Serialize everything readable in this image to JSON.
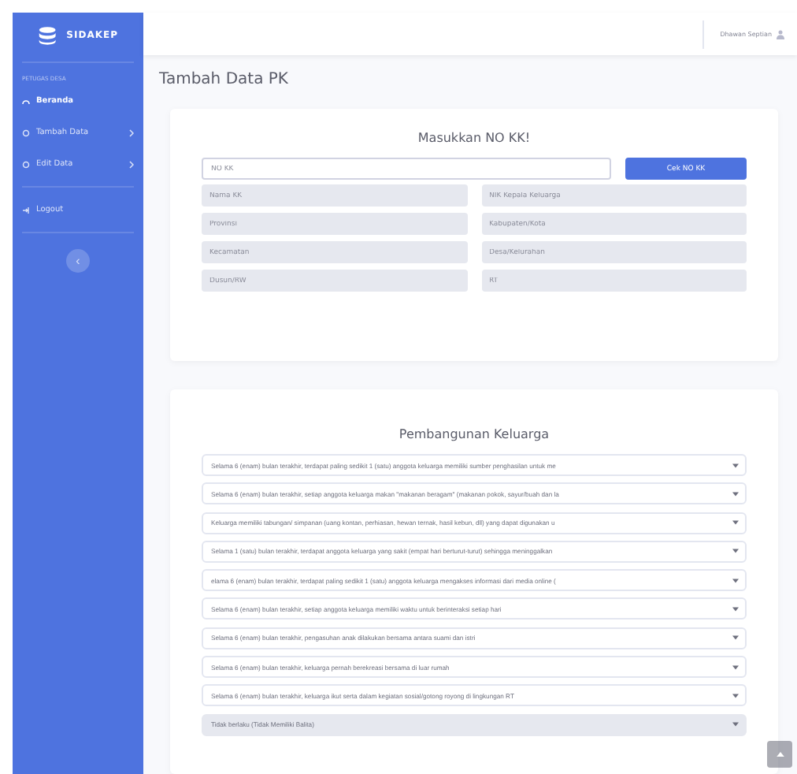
{
  "sidebar": {
    "brand": "SIDAKEP",
    "heading": "PETUGAS DESA",
    "items": [
      {
        "label": "Beranda",
        "kind": "dashboard",
        "chevron": false,
        "selected": true
      },
      {
        "label": "Tambah Data",
        "kind": "circle",
        "chevron": true,
        "selected": false
      },
      {
        "label": "Edit Data",
        "kind": "circle",
        "chevron": true,
        "selected": false
      },
      {
        "label": "Logout",
        "kind": "logout",
        "chevron": false,
        "selected": false
      }
    ],
    "toggle": "‹"
  },
  "topbar": {
    "user": "Dhawan Septian"
  },
  "page_title": "Tambah Data PK",
  "kk_card": {
    "title": "Masukkan NO KK!",
    "search": {
      "placeholder": "NO KK"
    },
    "button": "Cek NO KK",
    "fields": [
      {
        "placeholder": "Nama KK"
      },
      {
        "placeholder": "NIK Kepala Keluarga"
      },
      {
        "placeholder": "Provinsi"
      },
      {
        "placeholder": "Kabupaten/Kota"
      },
      {
        "placeholder": "Kecamatan"
      },
      {
        "placeholder": "Desa/Kelurahan"
      },
      {
        "placeholder": "Dusun/RW"
      },
      {
        "placeholder": "RT"
      }
    ]
  },
  "family_card": {
    "title": "Pembangunan Keluarga",
    "selects": [
      {
        "value": "Selama 6 (enam) bulan terakhir, terdapat paling sedikit 1 (satu) anggota keluarga memiliki sumber penghasilan untuk me",
        "disabled": false
      },
      {
        "value": "Selama 6 (enam) bulan terakhir, setiap anggota keluarga makan \"makanan beragam\" (makanan pokok, sayur/buah dan la",
        "disabled": false
      },
      {
        "value": "Keluarga memiliki tabungan/ simpanan (uang kontan, perhiasan, hewan ternak, hasil kebun, dll) yang dapat digunakan u",
        "disabled": false
      },
      {
        "value": "Selama 1 (satu) bulan terakhir, terdapat anggota keluarga yang sakit (empat hari berturut-turut) sehingga meninggalkan",
        "disabled": false
      },
      {
        "value": "elama 6 (enam) bulan terakhir, terdapat paling sedikit 1 (satu) anggota keluarga mengakses informasi dari media online (",
        "disabled": false
      },
      {
        "value": "Selama 6 (enam) bulan terakhir, setiap anggota keluarga memiliki waktu untuk berinteraksi setiap hari",
        "disabled": false
      },
      {
        "value": "Selama 6 (enam) bulan terakhir, pengasuhan anak dilakukan bersama antara suami dan istri",
        "disabled": false
      },
      {
        "value": "Selama 6 (enam) bulan terakhir, keluarga pernah berekreasi bersama di luar rumah",
        "disabled": false
      },
      {
        "value": "Selama 6 (enam) bulan terakhir, keluarga ikut serta dalam kegiatan sosial/gotong royong di lingkungan RT",
        "disabled": false
      },
      {
        "value": "Tidak berlaku (Tidak Memiliki Balita)",
        "disabled": true
      }
    ]
  }
}
